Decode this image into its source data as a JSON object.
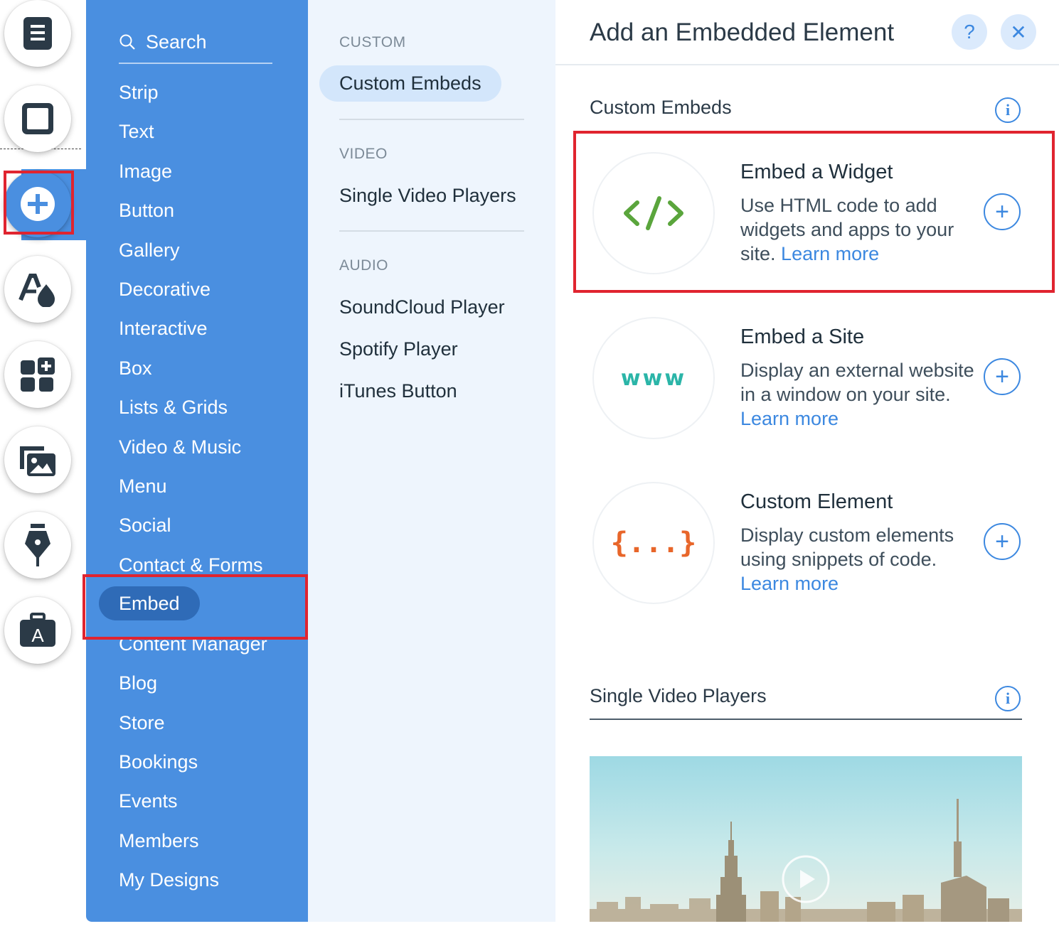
{
  "rail": {
    "buttons": [
      {
        "name": "pages-icon"
      },
      {
        "name": "background-icon"
      },
      {
        "name": "add-icon"
      },
      {
        "name": "design-icon"
      },
      {
        "name": "add-apps-icon"
      },
      {
        "name": "media-icon"
      },
      {
        "name": "blog-pen-icon"
      },
      {
        "name": "app-market-icon",
        "letter": "A"
      }
    ]
  },
  "categories": {
    "search_placeholder": "Search",
    "items": [
      "Strip",
      "Text",
      "Image",
      "Button",
      "Gallery",
      "Decorative",
      "Interactive",
      "Box",
      "Lists & Grids",
      "Video & Music",
      "Menu",
      "Social",
      "Contact & Forms",
      "Embed",
      "Content Manager",
      "Blog",
      "Store",
      "Bookings",
      "Events",
      "Members",
      "My Designs"
    ],
    "selected": "Embed"
  },
  "subcategories": {
    "groups": [
      {
        "heading": "CUSTOM",
        "items": [
          "Custom Embeds"
        ]
      },
      {
        "heading": "VIDEO",
        "items": [
          "Single Video Players"
        ]
      },
      {
        "heading": "AUDIO",
        "items": [
          "SoundCloud Player",
          "Spotify Player",
          "iTunes Button"
        ]
      }
    ],
    "selected": "Custom Embeds"
  },
  "main": {
    "title": "Add an Embedded Element",
    "help_label": "?",
    "close_label": "✕",
    "sections": [
      {
        "title": "Custom Embeds",
        "info": "i"
      },
      {
        "title": "Single Video Players",
        "info": "i"
      }
    ],
    "embeds": [
      {
        "name": "Embed a Widget",
        "desc": "Use HTML code to add widgets and apps to your site.",
        "link": "Learn more",
        "thumb": "</>",
        "thumb_color": "#5aa53c"
      },
      {
        "name": "Embed a Site",
        "desc": "Display an external website in a window on your site.",
        "link": "Learn more",
        "thumb": "www",
        "thumb_color": "#2bb5a8"
      },
      {
        "name": "Custom Element",
        "desc": "Display custom elements using snippets of code.",
        "link": "Learn more",
        "thumb": "{...}",
        "thumb_color": "#e8662a"
      }
    ],
    "add_label": "+"
  },
  "colors": {
    "accent": "#3c88e0",
    "panel_blue": "#4a8fe0",
    "highlight": "#e0242f"
  }
}
